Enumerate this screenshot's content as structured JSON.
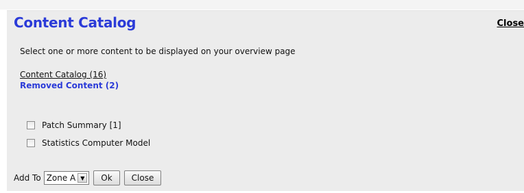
{
  "dialog": {
    "title": "Content Catalog",
    "close_link": "Close",
    "instructions": "Select one or more content to be displayed on your overview page",
    "catalog_link": "Content Catalog (16)",
    "removed_link": "Removed Content (2)"
  },
  "items": [
    {
      "label": "Patch Summary [1]",
      "checked": false
    },
    {
      "label": "Statistics Computer Model",
      "checked": false
    }
  ],
  "footer": {
    "add_to_label": "Add To",
    "zone_value": "Zone A",
    "ok_label": "Ok",
    "close_label": "Close"
  },
  "colors": {
    "title": "#2b3bd8",
    "panel_bg": "#ececec"
  },
  "icons": {
    "dropdown": "chevron-down-icon"
  }
}
